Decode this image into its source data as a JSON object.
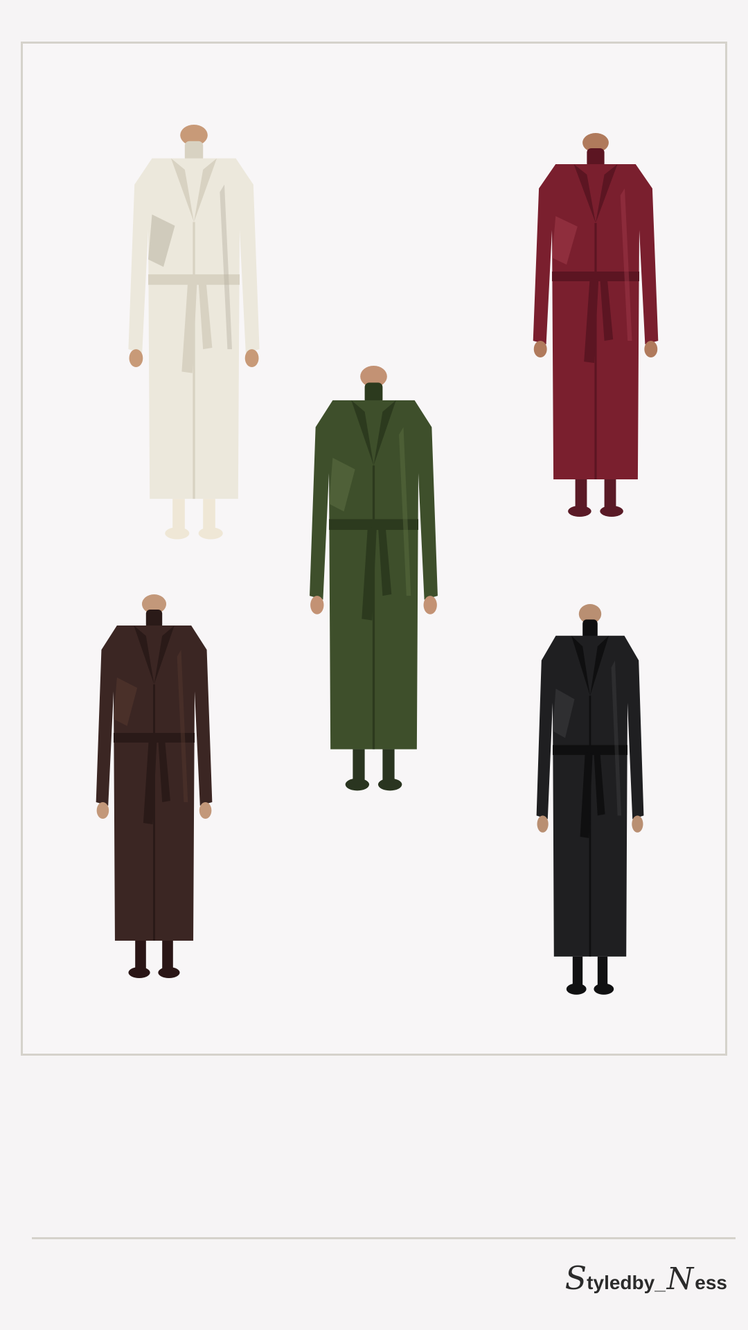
{
  "collage": {
    "items": [
      {
        "name": "cream trench coat",
        "color": "#ece8dc",
        "shade": "#d8d2c2",
        "accent": "#b9b2a2",
        "skin": "#c89a78",
        "shoe": "#efe7d6"
      },
      {
        "name": "burgundy leather trench coat",
        "color": "#7a1f2e",
        "shade": "#5c1522",
        "accent": "#a13a4b",
        "skin": "#b07a5c",
        "shoe": "#5a1a26"
      },
      {
        "name": "olive leather trench coat",
        "color": "#3e4f2b",
        "shade": "#2c3a1e",
        "accent": "#5d7043",
        "skin": "#c39274",
        "shoe": "#2a3520"
      },
      {
        "name": "brown leather trench coat",
        "color": "#3b2623",
        "shade": "#2a1a18",
        "accent": "#57392f",
        "skin": "#c3987a",
        "shoe": "#2a1616"
      },
      {
        "name": "black leather trench coat",
        "color": "#1f1f21",
        "shade": "#0f0f10",
        "accent": "#3d3d40",
        "skin": "#b98f72",
        "shoe": "#111112"
      }
    ]
  },
  "brand": {
    "initial": "S",
    "middle": "tyledby_",
    "n": "N",
    "end": "ess"
  }
}
